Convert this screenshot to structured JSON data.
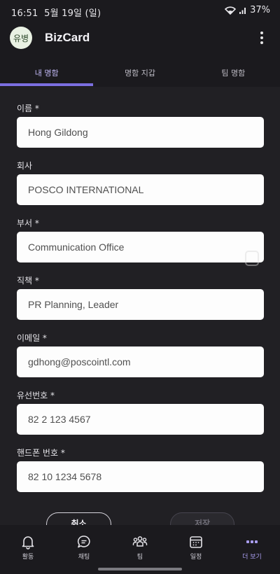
{
  "status_bar": {
    "time": "16:51",
    "date": "5월 19일 (일)",
    "battery": "37%"
  },
  "header": {
    "avatar_text": "유병",
    "title": "BizCard",
    "more_icon": "more-vertical-icon"
  },
  "tabs": [
    {
      "label": "내 명함",
      "active": true
    },
    {
      "label": "명함 지갑",
      "active": false
    },
    {
      "label": "팀 명함",
      "active": false
    }
  ],
  "form": {
    "fields": [
      {
        "label": "이름 *",
        "value": "Hong Gildong"
      },
      {
        "label": "회사",
        "value": "POSCO INTERNATIONAL"
      },
      {
        "label": "부서 *",
        "value": "Communication Office"
      },
      {
        "label": "직책 *",
        "value": "PR Planning, Leader"
      },
      {
        "label": "이메일 *",
        "value": "gdhong@poscointl.com"
      },
      {
        "label": "유선번호 *",
        "value": "82 2 123 4567"
      },
      {
        "label": "핸드폰 번호 *",
        "value": "82 10 1234 5678"
      }
    ],
    "cancel_label": "취소",
    "save_label": "저장"
  },
  "bottom_nav": [
    {
      "label": "활동",
      "icon": "bell-icon",
      "active": false
    },
    {
      "label": "채팅",
      "icon": "chat-icon",
      "active": false
    },
    {
      "label": "팀",
      "icon": "team-icon",
      "active": false
    },
    {
      "label": "일정",
      "icon": "calendar-icon",
      "active": false
    },
    {
      "label": "더 보기",
      "icon": "more-horizontal-icon",
      "active": true
    }
  ],
  "colors": {
    "accent": "#7b6fe0",
    "background": "#212024",
    "bar": "#1b1a1e"
  }
}
